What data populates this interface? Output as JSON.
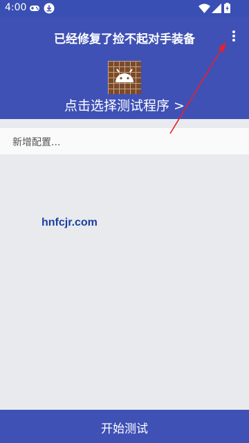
{
  "status_bar": {
    "time": "4:00",
    "icons": [
      "gamepad-icon",
      "download-icon",
      "wifi-icon",
      "signal-icon",
      "battery-icon"
    ]
  },
  "app_bar": {
    "title": "已经修复了捡不起对手装备",
    "menu_icon": "more-vert-icon"
  },
  "header": {
    "app_icon": "android-icon",
    "select_label": "点击选择测试程序 >"
  },
  "config": {
    "add_label": "新增配置..."
  },
  "watermark": {
    "text": "hnfcjr.com"
  },
  "footer": {
    "start_label": "开始测试"
  },
  "colors": {
    "primary": "#3f51b5",
    "status_bar": "#3a4fb3",
    "background": "#e9eaee",
    "annotation_arrow": "#e8202a"
  }
}
